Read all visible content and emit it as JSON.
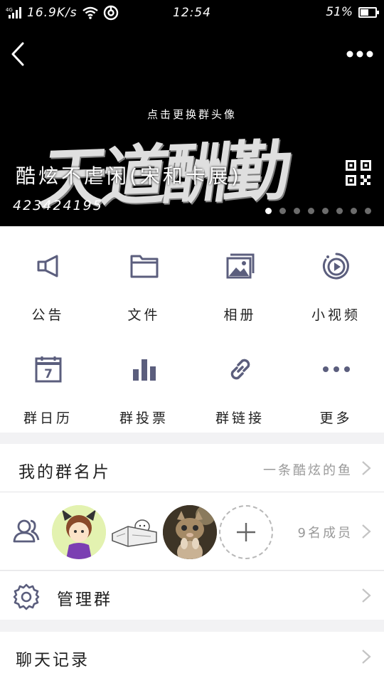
{
  "status_bar": {
    "signal": "4G",
    "net_speed": "16.9K/s",
    "time": "12:54",
    "battery_text": "51%",
    "battery_level": 0.51
  },
  "header": {
    "change_avatar_label": "点击更换群头像",
    "art_text": "天道酬勤",
    "group_name": "酷炫不虐闲(宋和卡展)",
    "group_id": "423424195",
    "page_count": 8,
    "active_page": 0
  },
  "grid": {
    "items": [
      {
        "label": "公告",
        "icon": "megaphone-icon"
      },
      {
        "label": "文件",
        "icon": "folder-icon"
      },
      {
        "label": "相册",
        "icon": "photo-album-icon"
      },
      {
        "label": "小视频",
        "icon": "short-video-icon"
      },
      {
        "label": "群日历",
        "icon": "calendar-icon"
      },
      {
        "label": "群投票",
        "icon": "bar-chart-icon"
      },
      {
        "label": "群链接",
        "icon": "link-icon"
      },
      {
        "label": "更多",
        "icon": "more-dots-icon"
      }
    ],
    "calendar_day": "7"
  },
  "list": {
    "card": {
      "title": "我的群名片",
      "value": "一条酷炫的鱼"
    },
    "members": {
      "value": "9名成员"
    },
    "manage": {
      "title": "管理群"
    },
    "chat": {
      "title": "聊天记录"
    }
  },
  "colors": {
    "header_bg": "#000000",
    "icon": "#5b5e7d",
    "text_secondary": "#999999",
    "page_bg": "#f2f2f4"
  }
}
